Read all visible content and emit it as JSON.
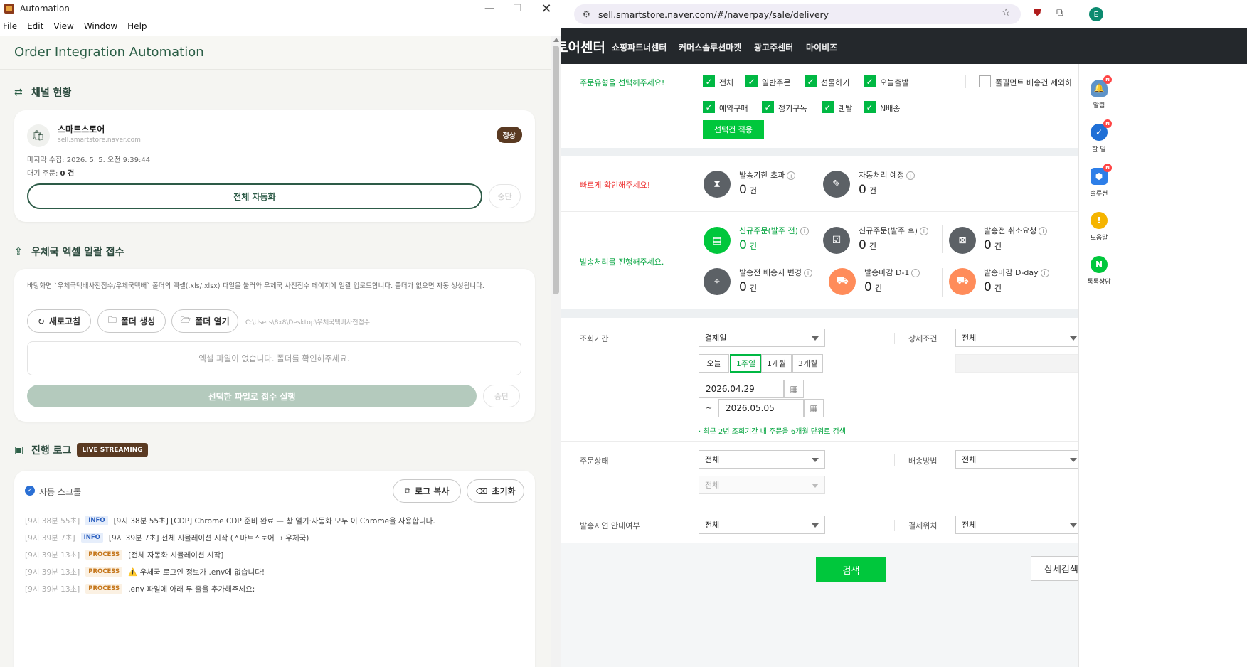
{
  "app": {
    "window_title": "Automation",
    "menu": [
      "File",
      "Edit",
      "View",
      "Window",
      "Help"
    ],
    "header_title": "Order Integration Automation",
    "channel_section": {
      "title": "채널 현황",
      "store_name": "스마트스토어",
      "store_url": "sell.smartstore.naver.com",
      "status": "정상",
      "last_collect_label": "마지막 수집:",
      "last_collect_value": "2026. 5. 5. 오전 9:39:44",
      "pending_label": "대기 주문:",
      "pending_value": "0 건",
      "auto_button": "전체 자동화",
      "stop_button": "중단"
    },
    "excel_section": {
      "title": "우체국 엑셀 일괄 접수",
      "description": "바탕화면 `우체국택배사전접수/우체국택배` 폴더의 엑셀(.xls/.xlsx) 파일을 불러와 우체국 사전접수 페이지에 일괄 업로드합니다. 폴더가 없으면 자동 생성됩니다.",
      "refresh_button": "새로고침",
      "create_folder_button": "폴더 생성",
      "open_folder_button": "폴더 열기",
      "folder_path": "C:\\Users\\8x8\\Desktop\\우체국택배사전접수",
      "empty_message": "엑셀 파일이 없습니다. 폴더를 확인해주세요.",
      "run_button": "선택한 파일로 접수 실행",
      "stop_button": "중단"
    },
    "log_section": {
      "title": "진행 로그",
      "live_badge": "LIVE STREAMING",
      "auto_scroll": "자동 스크롤",
      "copy_button": "로그 복사",
      "clear_button": "초기화",
      "lines": [
        {
          "time": "[9시 38분 55초]",
          "level": "INFO",
          "text": "[9시 38분 55초] [CDP] Chrome CDP 준비 완료 — 창 열기·자동화 모두 이 Chrome을 사용합니다."
        },
        {
          "time": "[9시 39분 7초]",
          "level": "INFO",
          "text": "[9시 39분 7초] 전체 시뮬레이션 시작 (스마트스토어 → 우체국)"
        },
        {
          "time": "[9시 39분 13초]",
          "level": "PROCESS",
          "text": "[전체 자동화 시뮬레이션 시작]"
        },
        {
          "time": "[9시 39분 13초]",
          "level": "PROCESS",
          "text": "⚠️ 우체국 로그인 정보가 .env에 없습니다!"
        },
        {
          "time": "[9시 39분 13초]",
          "level": "PROCESS",
          "text": ".env 파일에 아래 두 줄을 추가해주세요:"
        }
      ]
    }
  },
  "browser": {
    "url": "sell.smartstore.naver.com/#/naverpay/sale/delivery",
    "brand": "토어센터",
    "nav": [
      "쇼핑파트너센터",
      "커머스솔루션마켓",
      "광고주센터",
      "마이비즈"
    ],
    "order_type": {
      "label": "주문유형을 선택해주세요!",
      "options_row1": [
        {
          "label": "전체",
          "checked": true
        },
        {
          "label": "일반주문",
          "checked": true
        },
        {
          "label": "선물하기",
          "checked": true
        },
        {
          "label": "오늘출발",
          "checked": true
        }
      ],
      "fulfillment": {
        "label": "풀필먼트 배송건 제외하",
        "checked": false
      },
      "options_row2": [
        {
          "label": "예약구매",
          "checked": true
        },
        {
          "label": "정기구독",
          "checked": true
        },
        {
          "label": "렌탈",
          "checked": true
        },
        {
          "label": "N배송",
          "checked": true
        }
      ],
      "apply_button": "선택건 적용"
    },
    "quick_check": {
      "label": "빠르게 확인해주세요!",
      "items": [
        {
          "title": "발송기한 초과",
          "value": "0",
          "unit": "건"
        },
        {
          "title": "자동처리 예정",
          "value": "0",
          "unit": "건"
        }
      ]
    },
    "process": {
      "label": "발송처리를 진행해주세요.",
      "items": [
        {
          "title": "신규주문(발주 전)",
          "value": "0",
          "unit": "건"
        },
        {
          "title": "신규주문(발주 후)",
          "value": "0",
          "unit": "건"
        },
        {
          "title": "발송전 취소요청",
          "value": "0",
          "unit": "건"
        },
        {
          "title": "발송전 배송지 변경",
          "value": "0",
          "unit": "건"
        },
        {
          "title": "발송마감 D-1",
          "value": "0",
          "unit": "건"
        },
        {
          "title": "발송마감 D-day",
          "value": "0",
          "unit": "건"
        }
      ]
    },
    "filters": {
      "period_label": "조회기간",
      "period_select": "결제일",
      "ranges": [
        "오늘",
        "1주일",
        "1개월",
        "3개월"
      ],
      "active_range": "1주일",
      "date_from": "2026.04.29",
      "tilde": "~",
      "date_to": "2026.05.05",
      "note": "· 최근 2년 조회기간 내 주문을 6개월 단위로 검색",
      "detail_label": "상세조건",
      "detail_select": "전체",
      "status_label": "주문상태",
      "status_select": "전체",
      "status_sub_select": "전체",
      "delivery_label": "배송방법",
      "delivery_select": "전체",
      "delay_label": "발송지연 안내여부",
      "delay_select": "전체",
      "payloc_label": "결제위치",
      "payloc_select": "전체",
      "search_button": "검색",
      "detail_search_button": "상세검색"
    },
    "right_sidebar": [
      {
        "label": "알림",
        "badge": "N"
      },
      {
        "label": "할 일",
        "badge": "N"
      },
      {
        "label": "솔루션",
        "badge": "N"
      },
      {
        "label": "도움말",
        "badge": ""
      },
      {
        "label": "톡톡상담",
        "badge": ""
      }
    ],
    "profile_initial": "E"
  }
}
